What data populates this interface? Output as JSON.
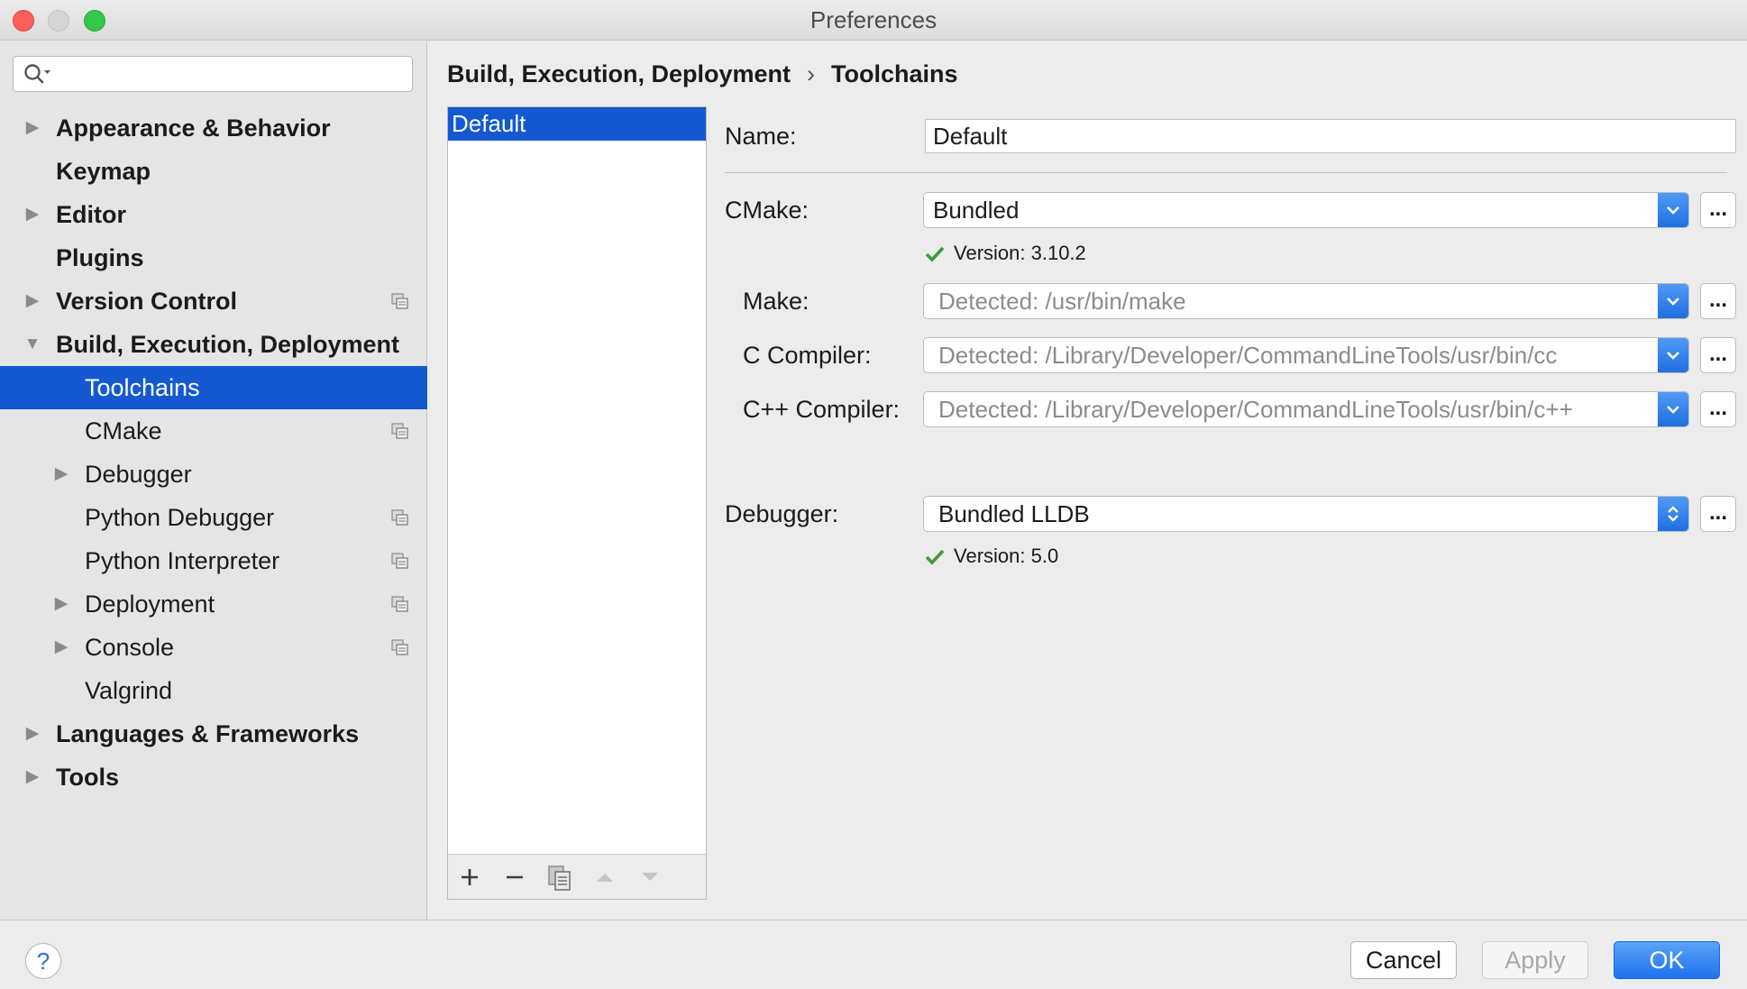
{
  "window": {
    "title": "Preferences"
  },
  "search": {
    "value": "",
    "placeholder": ""
  },
  "sidebar": {
    "items": [
      {
        "label": "Appearance & Behavior",
        "level": 0,
        "bold": true,
        "arrow": "right"
      },
      {
        "label": "Keymap",
        "level": 0,
        "bold": true,
        "arrow": "none"
      },
      {
        "label": "Editor",
        "level": 0,
        "bold": true,
        "arrow": "right"
      },
      {
        "label": "Plugins",
        "level": 0,
        "bold": true,
        "arrow": "none"
      },
      {
        "label": "Version Control",
        "level": 0,
        "bold": true,
        "arrow": "right",
        "project_icon": true
      },
      {
        "label": "Build, Execution, Deployment",
        "level": 0,
        "bold": true,
        "arrow": "down"
      },
      {
        "label": "Toolchains",
        "level": 1,
        "bold": false,
        "arrow": "none",
        "selected": true
      },
      {
        "label": "CMake",
        "level": 1,
        "bold": false,
        "arrow": "none",
        "project_icon": true
      },
      {
        "label": "Debugger",
        "level": 1,
        "bold": false,
        "arrow": "right"
      },
      {
        "label": "Python Debugger",
        "level": 1,
        "bold": false,
        "arrow": "none",
        "project_icon": true
      },
      {
        "label": "Python Interpreter",
        "level": 1,
        "bold": false,
        "arrow": "none",
        "project_icon": true
      },
      {
        "label": "Deployment",
        "level": 1,
        "bold": false,
        "arrow": "right",
        "project_icon": true
      },
      {
        "label": "Console",
        "level": 1,
        "bold": false,
        "arrow": "right",
        "project_icon": true
      },
      {
        "label": "Valgrind",
        "level": 1,
        "bold": false,
        "arrow": "none"
      },
      {
        "label": "Languages & Frameworks",
        "level": 0,
        "bold": true,
        "arrow": "right"
      },
      {
        "label": "Tools",
        "level": 0,
        "bold": true,
        "arrow": "right"
      }
    ]
  },
  "breadcrumb": {
    "parent": "Build, Execution, Deployment",
    "separator": "›",
    "current": "Toolchains"
  },
  "toolchains": {
    "items": [
      "Default"
    ],
    "selected_index": 0,
    "toolbar": {
      "add": "+",
      "remove": "−"
    }
  },
  "form": {
    "name_label": "Name:",
    "name_value": "Default",
    "cmake_label": "CMake:",
    "cmake_value": "Bundled",
    "cmake_version": "Version: 3.10.2",
    "make_label": "Make:",
    "make_value": "Detected: /usr/bin/make",
    "c_compiler_label": "C Compiler:",
    "c_compiler_value": "Detected: /Library/Developer/CommandLineTools/usr/bin/cc",
    "cpp_compiler_label": "C++ Compiler:",
    "cpp_compiler_value": "Detected: /Library/Developer/CommandLineTools/usr/bin/c++",
    "debugger_label": "Debugger:",
    "debugger_value": "Bundled LLDB",
    "debugger_version": "Version: 5.0",
    "browse_label": "..."
  },
  "footer": {
    "help": "?",
    "cancel": "Cancel",
    "apply": "Apply",
    "ok": "OK"
  },
  "colors": {
    "selection": "#1459cf",
    "accent": "#1e72ee",
    "check": "#3f9b3a"
  }
}
